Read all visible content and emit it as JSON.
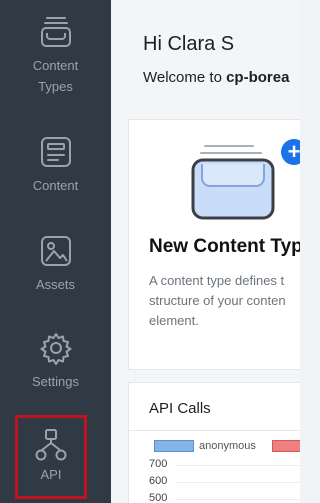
{
  "sidebar": {
    "items": [
      {
        "label_line1": "Content",
        "label_line2": "Types",
        "icon": "content-types-icon"
      },
      {
        "label": "Content",
        "icon": "content-icon"
      },
      {
        "label": "Assets",
        "icon": "image-icon"
      },
      {
        "label": "Settings",
        "icon": "gear-icon"
      },
      {
        "label": "API",
        "icon": "api-icon",
        "highlighted": true
      }
    ]
  },
  "header": {
    "greeting": "Hi Clara S",
    "welcome_prefix": "Welcome to ",
    "welcome_stack": "cp-borea"
  },
  "content_type_card": {
    "title": "New Content Typ",
    "desc_lines": [
      "A content type defines t",
      "structure of your conten",
      "element."
    ],
    "add_symbol": "+"
  },
  "api_card": {
    "title": "API Calls",
    "chart": {
      "legend": [
        "anonymous"
      ],
      "y_ticks": [
        "700",
        "600",
        "500"
      ]
    }
  },
  "colors": {
    "sidebar_bg": "#2f3a45",
    "accent": "#1a73e8",
    "highlight_border": "#c1121f"
  }
}
